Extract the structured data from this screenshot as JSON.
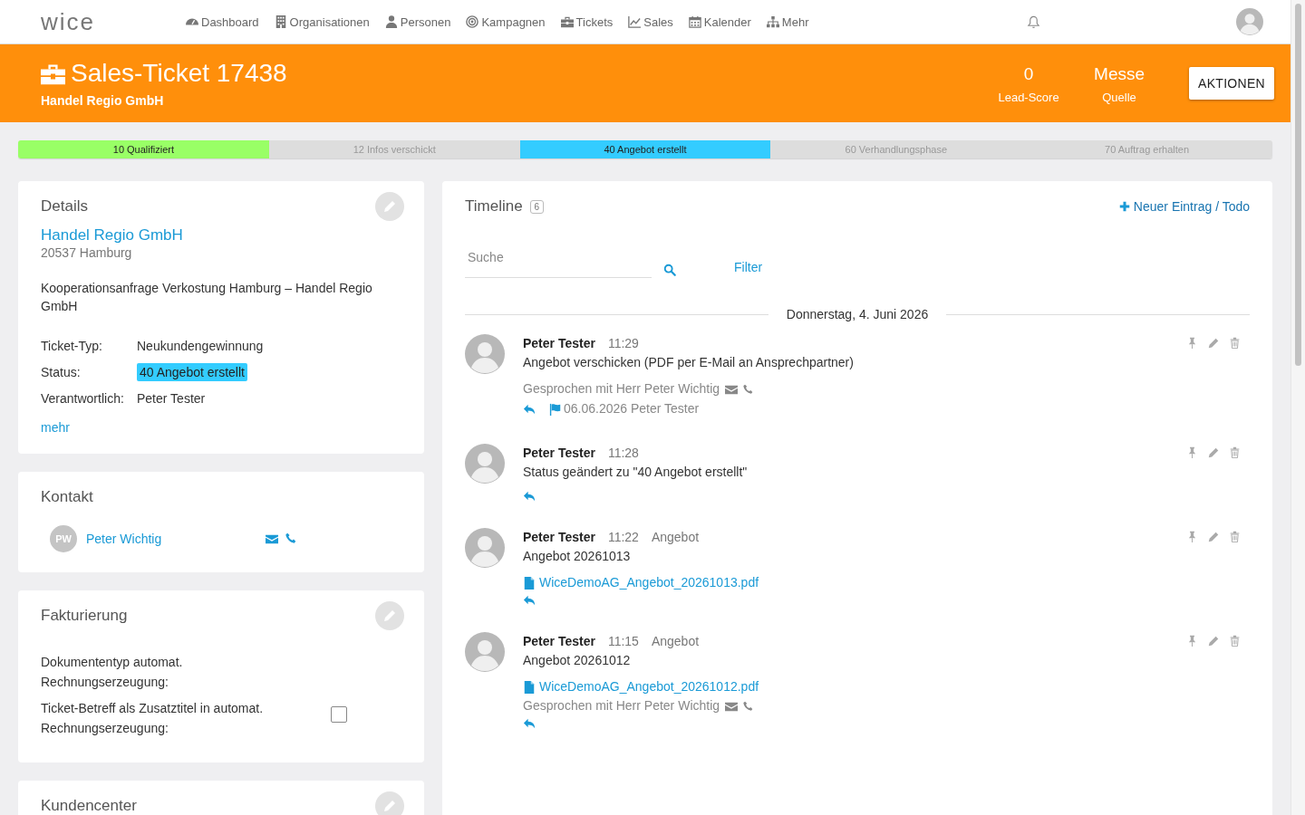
{
  "logo": "wice",
  "nav": [
    {
      "label": "Dashboard"
    },
    {
      "label": "Organisationen"
    },
    {
      "label": "Personen"
    },
    {
      "label": "Kampagnen"
    },
    {
      "label": "Tickets"
    },
    {
      "label": "Sales"
    },
    {
      "label": "Kalender"
    },
    {
      "label": "Mehr"
    }
  ],
  "header": {
    "title": "Sales-Ticket 17438",
    "subtitle": "Handel Regio GmbH",
    "stats": [
      {
        "value": "0",
        "label": "Lead-Score"
      },
      {
        "value": "Messe",
        "label": "Quelle"
      }
    ],
    "action": "AKTIONEN"
  },
  "stages": [
    {
      "label": "10 Qualifiziert",
      "color": "#99ff66",
      "active": true
    },
    {
      "label": "12 Infos verschickt",
      "color": "#dddddd",
      "active": false
    },
    {
      "label": "40 Angebot erstellt",
      "color": "#33ccff",
      "active": true
    },
    {
      "label": "60 Verhandlungsphase",
      "color": "#dddddd",
      "active": false
    },
    {
      "label": "70 Auftrag erhalten",
      "color": "#dddddd",
      "active": false
    }
  ],
  "details": {
    "title": "Details",
    "company": "Handel Regio GmbH",
    "city": "20537 Hamburg",
    "description": "Kooperationsanfrage Verkostung Hamburg – Handel Regio GmbH",
    "fields": [
      {
        "label": "Ticket-Typ:",
        "value": "Neukundengewinnung",
        "kind": "text"
      },
      {
        "label": "Status:",
        "value": "40 Angebot erstellt",
        "kind": "badge"
      },
      {
        "label": "Verantwortlich:",
        "value": "Peter Tester",
        "kind": "text"
      }
    ],
    "more": "mehr"
  },
  "contact": {
    "title": "Kontakt",
    "people": [
      {
        "initials": "PW",
        "name": "Peter Wichtig"
      }
    ]
  },
  "billing": {
    "title": "Fakturierung",
    "fields": [
      {
        "label": "Dokumententyp automat. Rechnungserzeugung:",
        "kind": "text"
      },
      {
        "label": "Ticket-Betreff als Zusatztitel in automat. Rechnungserzeugung:",
        "kind": "checkbox",
        "checked": false
      }
    ]
  },
  "customer_center": {
    "title": "Kundencenter"
  },
  "timeline": {
    "title": "Timeline",
    "count": "6",
    "new_entry": "Neuer Eintrag / Todo",
    "search": {
      "placeholder": "Suche"
    },
    "filter": "Filter",
    "date": "Donnerstag, 4. Juni 2026",
    "entries": [
      {
        "author": "Peter Tester",
        "time": "11:29",
        "text": "Angebot verschicken (PDF per E-Mail an Ansprechpartner)",
        "note": "Gesprochen mit Herr Peter Wichtig",
        "followup": "06.06.2026 Peter Tester"
      },
      {
        "author": "Peter Tester",
        "time": "11:28",
        "text": "Status geändert zu \"40 Angebot erstellt\""
      },
      {
        "author": "Peter Tester",
        "time": "11:22",
        "category": "Angebot",
        "text": "Angebot 20261013",
        "attachment": "WiceDemoAG_Angebot_20261013.pdf"
      },
      {
        "author": "Peter Tester",
        "time": "11:15",
        "category": "Angebot",
        "text": "Angebot 20261012",
        "attachment": "WiceDemoAG_Angebot_20261012.pdf",
        "note": "Gesprochen mit Herr Peter Wichtig"
      }
    ]
  }
}
